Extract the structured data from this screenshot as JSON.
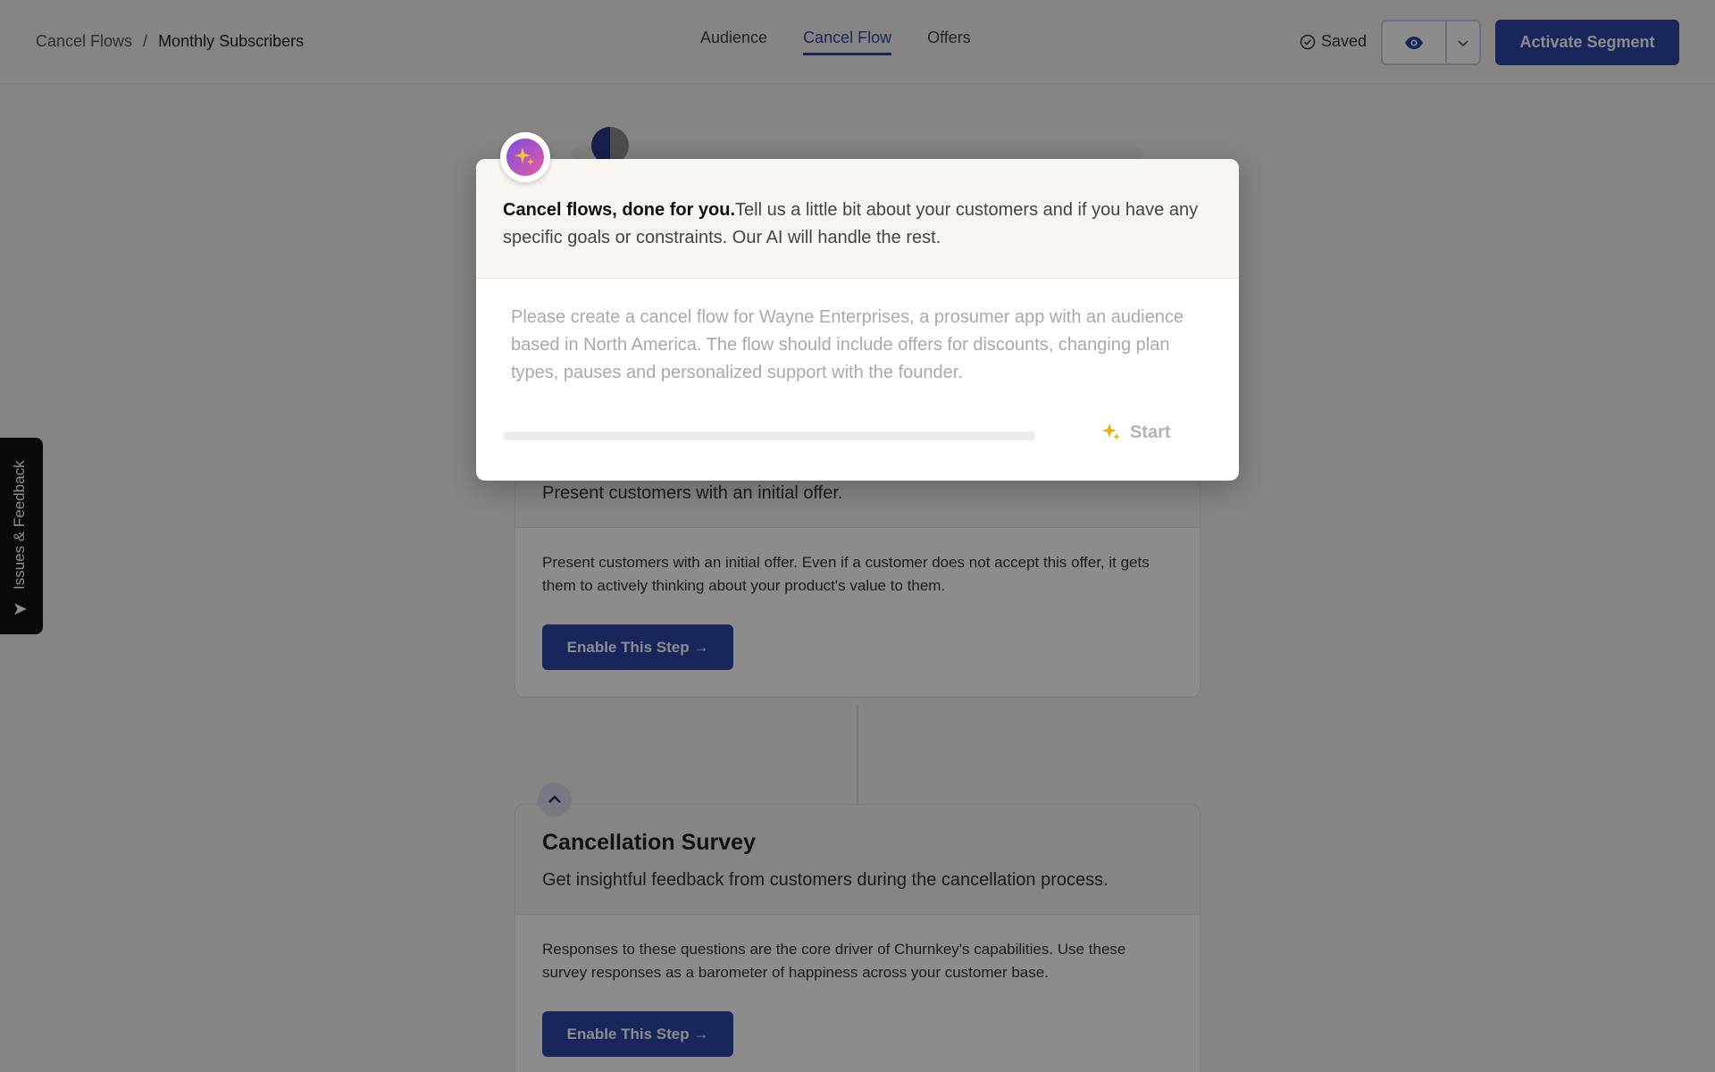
{
  "breadcrumb": {
    "parent": "Cancel Flows",
    "separator": "/",
    "current": "Monthly Subscribers"
  },
  "tabs": [
    {
      "label": "Audience",
      "active": false
    },
    {
      "label": "Cancel Flow",
      "active": true
    },
    {
      "label": "Offers",
      "active": false
    }
  ],
  "status": {
    "saved_label": "Saved"
  },
  "actions": {
    "activate_label": "Activate Segment"
  },
  "feedback_tab": {
    "label": "Issues & Feedback"
  },
  "cards": [
    {
      "subtitle": "Present customers with an initial offer.",
      "body": "Present customers with an initial offer. Even if a customer does not accept this offer, it gets them to actively thinking about your product's value to them.",
      "button_label": "Enable This Step →"
    },
    {
      "title": "Cancellation Survey",
      "subtitle": "Get insightful feedback from customers during the cancellation process.",
      "body": "Responses to these questions are the core driver of Churnkey's capabilities. Use these survey responses as a barometer of happiness across your customer base.",
      "button_label": "Enable This Step →"
    }
  ],
  "modal": {
    "headline_bold": "Cancel flows, done for you.",
    "headline_rest": "Tell us a little bit about your customers and if you have any specific goals or constraints. Our AI will handle the rest.",
    "prompt_placeholder": "Please create a cancel flow for Wayne Enterprises, a prosumer app with an audience based in North America. The flow should include offers for discounts, changing plan types, pauses and personalized support with the founder.",
    "start_label": "Start",
    "progress": 0
  },
  "colors": {
    "brand": "#2f45a8",
    "accent_star": "#e8b10c",
    "ai_gradient_start": "#7a4fe0",
    "ai_gradient_end": "#e65aa3"
  },
  "icons": [
    "check-circle-icon",
    "eye-icon",
    "chevron-down-icon",
    "send-arrow-icon",
    "sparkle-icon",
    "chevron-up-icon"
  ]
}
